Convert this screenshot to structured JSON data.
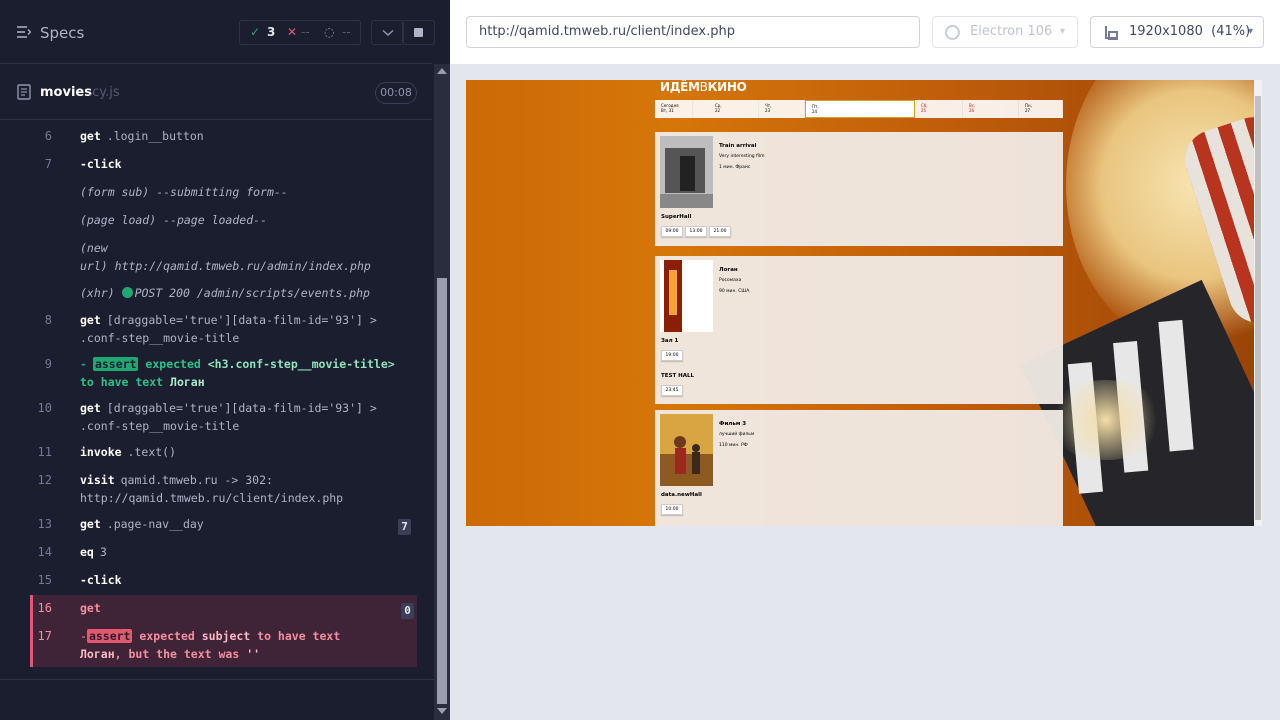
{
  "reporter": {
    "specs_label": "Specs",
    "stats": {
      "passed": "3",
      "failed": "--",
      "pending": "--"
    },
    "spec_file": {
      "name": "movies",
      "ext": ".cy.js",
      "duration": "00:08"
    }
  },
  "log": {
    "r6": {
      "num": "6",
      "cmd": "get",
      "msg": ".login__button"
    },
    "r7": {
      "num": "7",
      "cmd": "-click"
    },
    "form_sub": {
      "label": "(form sub)",
      "msg": "--submitting form--"
    },
    "page_load": {
      "label": "(page load)",
      "msg": "--page loaded--"
    },
    "new_url": {
      "label1": "(new",
      "label2": "url)",
      "msg": "http://qamid.tmweb.ru/admin/index.php"
    },
    "xhr": {
      "label": "(xhr)",
      "msg": "POST 200 /admin/scripts/events.php"
    },
    "r8": {
      "num": "8",
      "cmd": "get",
      "msg1": "[draggable='true'][data-film-id='93'] >",
      "msg2": ".conf-step__movie-title"
    },
    "r9": {
      "num": "9",
      "dash": "-",
      "tag": "assert",
      "expected": "expected",
      "subject": "<h3.conf-step__movie-title>",
      "to_have": "to have text",
      "value": "Логан"
    },
    "r10": {
      "num": "10",
      "cmd": "get",
      "msg1": "[draggable='true'][data-film-id='93'] >",
      "msg2": ".conf-step__movie-title"
    },
    "r11": {
      "num": "11",
      "cmd": "invoke",
      "msg": ".text()"
    },
    "r12": {
      "num": "12",
      "cmd": "visit",
      "msg1": "qamid.tmweb.ru -> 302:",
      "msg2": "http://qamid.tmweb.ru/client/index.php"
    },
    "r13": {
      "num": "13",
      "cmd": "get",
      "msg": ".page-nav__day",
      "badge": "7"
    },
    "r14": {
      "num": "14",
      "cmd": "eq",
      "msg": "3"
    },
    "r15": {
      "num": "15",
      "cmd": "-click"
    },
    "r16": {
      "num": "16",
      "cmd": "get",
      "badge": "0"
    },
    "r17": {
      "num": "17",
      "dash": "-",
      "tag": "assert",
      "expected": "expected",
      "subject": "subject",
      "to_have": "to have text",
      "value": "Логан",
      "rest": ", but the text was",
      "actual": "''"
    }
  },
  "browser_bar": {
    "url": "http://qamid.tmweb.ru/client/index.php",
    "browser": "Electron 106",
    "viewport": "1920x1080",
    "scale": "(41%)"
  },
  "app": {
    "logo": {
      "a": "ИДЁМ",
      "b": "В",
      "c": "КИНО"
    },
    "days": [
      {
        "d": "Сегодня",
        "n": "Вт, 31"
      },
      {
        "d": "Ср,",
        "n": "22"
      },
      {
        "d": "Чт,",
        "n": "23"
      },
      {
        "d": "Пт,",
        "n": "24"
      },
      {
        "d": "Сб,",
        "n": "25"
      },
      {
        "d": "Вс,",
        "n": "26"
      },
      {
        "d": "Пн,",
        "n": "27"
      }
    ],
    "movies": [
      {
        "title": "Train arrival",
        "desc": "Very interesting film",
        "meta": "1 мин. Франс",
        "halls": [
          {
            "name": "SuperHall",
            "times": [
              "09:00",
              "13:00",
              "21:00"
            ]
          }
        ]
      },
      {
        "title": "Логан",
        "desc": "Росомаха",
        "meta": "90 мин. США",
        "halls": [
          {
            "name": "Зал 1",
            "times": [
              "19:00"
            ]
          },
          {
            "name": "TEST HALL",
            "times": [
              "23:45"
            ]
          }
        ]
      },
      {
        "title": "Фильм 3",
        "desc": "лучший фильм",
        "meta": "110 мин. РФ",
        "halls": [
          {
            "name": "data.newHall",
            "times": [
              "10:00"
            ]
          }
        ]
      }
    ]
  },
  "colors": {
    "pass": "#1fa971",
    "fail": "#e45770",
    "panel": "#1b1e2e"
  }
}
